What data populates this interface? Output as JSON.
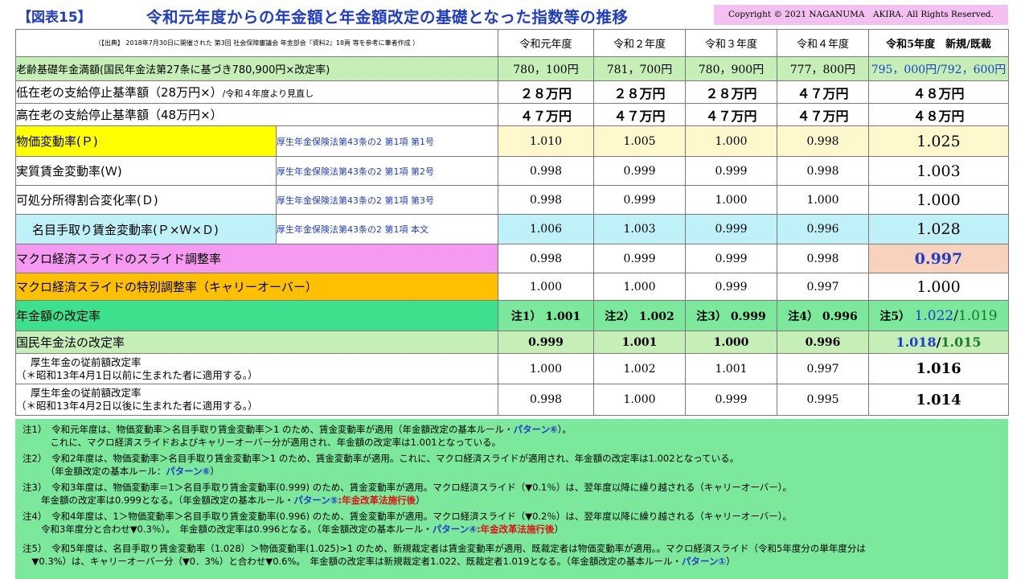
{
  "header": {
    "fig_label": "【図表15】",
    "title": "令和元年度からの年金額と年金額改定の基礎となった指数等の推移",
    "copyright": "Copyright © 2021  NAGANUMA　AKIRA.  All Rights Reserved."
  },
  "table": {
    "source_note": "（【出典】 2018年7月30日に開催された 第3回 社会保障審議会 年金部会『資料2』18頁 等を参考に筆者作成 ）",
    "columns": [
      "令和元年度",
      "令和２年度",
      "令和３年度",
      "令和４年度",
      "令和5年度　新規/既裁"
    ],
    "rows": [
      {
        "label": "老齢基礎年金満額(国民年金法第27条に基づき780,900円×改定率)",
        "law": "",
        "values": [
          "780，100円",
          "781，700円",
          "780，900円",
          "777，800円"
        ],
        "v5a": "795，000円",
        "v5sep": "/",
        "v5b": "792，600円",
        "bg": "#c6efb8",
        "law_bg": ""
      },
      {
        "label": "低在老の支給停止基準額（28万円×）",
        "label_suffix": "/令和４年度より見直し",
        "law": "",
        "values": [
          "２８万円",
          "２８万円",
          "２８万円",
          "４７万円"
        ],
        "v5": "４８万円",
        "bg": "#ffffff",
        "law_bg": ""
      },
      {
        "label": "高在老の支給停止基準額（48万円×）",
        "law": "",
        "values": [
          "４７万円",
          "４７万円",
          "４７万円",
          "４７万円"
        ],
        "v5": "４８万円",
        "bg": "#ffffff",
        "law_bg": ""
      },
      {
        "label": "物価変動率(Ｐ)",
        "law": "厚生年金保険法第43条の2 第1項 第1号",
        "values": [
          "1.010",
          "1.005",
          "1.000",
          "0.998"
        ],
        "v5": "1.025",
        "bg": "#ffff00",
        "val_bg": "#fff8cc"
      },
      {
        "label": "実質賃金変動率(Ｗ)",
        "law": "厚生年金保険法第43条の2 第1項 第2号",
        "values": [
          "0.998",
          "0.999",
          "0.999",
          "0.998"
        ],
        "v5": "1.003",
        "bg": "#ffffff",
        "val_bg": "#ffffff"
      },
      {
        "label": "可処分所得割合変化率(Ｄ)",
        "law": "厚生年金保険法第43条の2 第1項 第3号",
        "values": [
          "0.998",
          "0.999",
          "1.000",
          "1.000"
        ],
        "v5": "1.000",
        "bg": "#ffffff",
        "val_bg": "#ffffff"
      },
      {
        "label": "名目手取り賃金変動率(Ｐ×Ｗ×Ｄ)",
        "law": "厚生年金保険法第43条の2 第1項 本文",
        "values": [
          "1.006",
          "1.003",
          "0.999",
          "0.996"
        ],
        "v5": "1.028",
        "bg": "#bff2f8",
        "val_bg": "#bff2f8"
      },
      {
        "label": "マクロ経済スライドのスライド調整率",
        "values": [
          "0.998",
          "0.999",
          "0.999",
          "0.998"
        ],
        "v5": "0.997",
        "bg": "#f59af0",
        "v5_bg": "#f9d2bd"
      },
      {
        "label": "マクロ経済スライドの特別調整率（キャリーオーバー）",
        "values": [
          "1.000",
          "1.000",
          "0.999",
          "0.997"
        ],
        "v5": "1.000",
        "bg": "#ffc000"
      },
      {
        "label": "年金額の改定率",
        "values": [
          "注1） 1.001",
          "注2） 1.002",
          "注3） 0.999",
          "注4） 0.996"
        ],
        "v5pre": "注5）",
        "v5a": "1.022",
        "v5sep": "/",
        "v5b": "1.019",
        "bg": "#3de08c",
        "val_bg": "#7be89c"
      },
      {
        "label": "国民年金法の改定率",
        "values": [
          "0.999",
          "1.001",
          "1.000",
          "0.996"
        ],
        "v5a": "1.018",
        "v5sep": "/",
        "v5b": "1.015",
        "bg": "#c6efb8",
        "val_bg": "#c6efb8"
      },
      {
        "label_line1": "厚生年金の従前額改定率",
        "label_line2": "（＊昭和13年4月1日以前に生まれた者に適用する。）",
        "values": [
          "1.000",
          "1.002",
          "1.001",
          "0.997"
        ],
        "v5": "1.016",
        "bg": "#ffffff"
      },
      {
        "label_line1": "厚生年金の従前額改定率",
        "label_line2": "（＊昭和13年4月2日以後に生まれた者に適用する。）",
        "values": [
          "0.998",
          "1.000",
          "0.999",
          "0.995"
        ],
        "v5": "1.014",
        "bg": "#ffffff"
      }
    ]
  },
  "notes": [
    {
      "text": "注1）　令和元年度は、物価変動率＞名目手取り賃金変動率＞1 のため、賃金変動率が適用（年金額改定の基本ルール・",
      "pattern": "パターン⑥",
      "after": "）。"
    },
    {
      "text": "　　　これに、マクロ経済スライドおよびキャリーオーバー分が適用され、年金額の改定率は1.001となっている。"
    },
    {
      "text": "注2）　令和2年度は、物価変動率＞名目手取り賃金変動率＞1 のため、賃金変動率が適用。これに、マクロ経済スライドが適用され、年金額の改定率は1.002となっている。"
    },
    {
      "text": "　　　（年金額改定の基本ルール：",
      "pattern": "パターン⑥",
      "after": "）"
    },
    {
      "text": "注3）　令和3年度は、物価変動率＝1＞名目手取り賃金変動率(0.999) のため、賃金変動率が適用。マクロ経済スライド（▼0.1％）は、翌年度以降に繰り越される（キャリーオーバー）。"
    },
    {
      "text": "　　年金額の改定率は0.999となる。（年金額改定の基本ルール・",
      "pattern": "パターン⑤",
      "red": ":年金改革法施行後",
      "after": "）"
    },
    {
      "text": "注4）　令和4年度は、1＞物価変動率＞名目手取り賃金変動率(0.996) のため、賃金変動率が適用。マクロ経済スライド（▼0.2％）は、翌年度以降に繰り越される（キャリーオーバー）。"
    },
    {
      "text": "　　令和3年度分と合わせ▼0.3％）。　年金額の改定率は0.996となる。（年金額改定の基本ルール・",
      "pattern": "パターン④",
      "red": ":年金改革法施行後",
      "after": "）"
    },
    {
      "text": "注5）　令和5年度は、名目手取り賃金変動率（1.028）＞物価変動率(1.025)>1 のため、新規裁定者は賃金変動率が適用、既裁定者は物価変動率が適用。。マクロ経済スライド（令和5年度分の単年度分は"
    },
    {
      "text": "　▼0.3%）は、キャリーオーバー分（▼0．3%）と合わせ▼0.6%。　年金額の改定率は新規裁定者1.022、既裁定者1.019となる。（年金額改定の基本ルール・",
      "pattern": "パターン①",
      "after": "）"
    }
  ]
}
